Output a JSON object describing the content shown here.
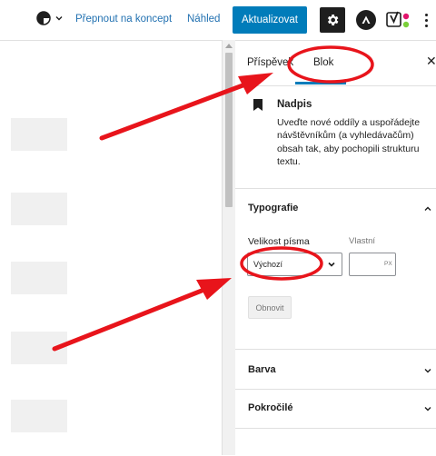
{
  "toolbar": {
    "draft_label": "Přepnout na koncept",
    "preview_label": "Náhled",
    "update_label": "Aktualizovat",
    "accent_color": "#007cba",
    "icons": [
      "half-circle-style-icon",
      "chevron-down-icon",
      "gear-icon",
      "plugin-a-icon",
      "yoast-icon",
      "more-vertical-icon"
    ]
  },
  "sidebar": {
    "tabs": [
      {
        "label": "Příspěvek",
        "active": false
      },
      {
        "label": "Blok",
        "active": true
      }
    ],
    "block": {
      "title": "Nadpis",
      "description": "Uveďte nové oddíly a uspořádejte návštěvníkům (a vyhledávačům) obsah tak, aby pochopili strukturu textu."
    },
    "typography": {
      "title": "Typografie",
      "font_size_label": "Velikost písma",
      "custom_label": "Vlastní",
      "select_value": "Výchozí",
      "unit": "PX",
      "reset_label": "Obnovit"
    },
    "panels": [
      {
        "title": "Barva"
      },
      {
        "title": "Pokročilé"
      }
    ]
  },
  "annotations": {
    "highlight_color": "#e8141b"
  }
}
